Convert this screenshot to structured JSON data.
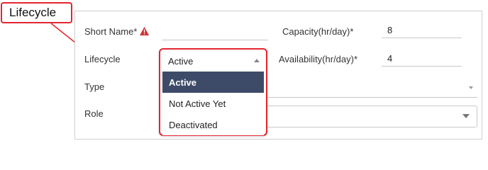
{
  "callout": {
    "label": "Lifecycle"
  },
  "form": {
    "short_name": {
      "label": "Short Name*",
      "value": ""
    },
    "capacity": {
      "label": "Capacity(hr/day)*",
      "value": "8"
    },
    "lifecycle": {
      "label": "Lifecycle",
      "selected": "Active"
    },
    "availability": {
      "label": "Availability(hr/day)*",
      "value": "4"
    },
    "type": {
      "label": "Type"
    },
    "role": {
      "label": "Role"
    }
  },
  "lifecycle_dropdown": {
    "options": [
      {
        "label": "Active",
        "selected": true
      },
      {
        "label": "Not Active Yet",
        "selected": false
      },
      {
        "label": "Deactivated",
        "selected": false
      }
    ]
  },
  "colors": {
    "highlight_border": "#e3262f",
    "selected_option_bg": "#3d4b69",
    "warning_icon": "#d32f2f"
  },
  "icons": [
    "warning-icon",
    "chevron-down-icon",
    "chevron-up-icon",
    "callout-arrow"
  ]
}
